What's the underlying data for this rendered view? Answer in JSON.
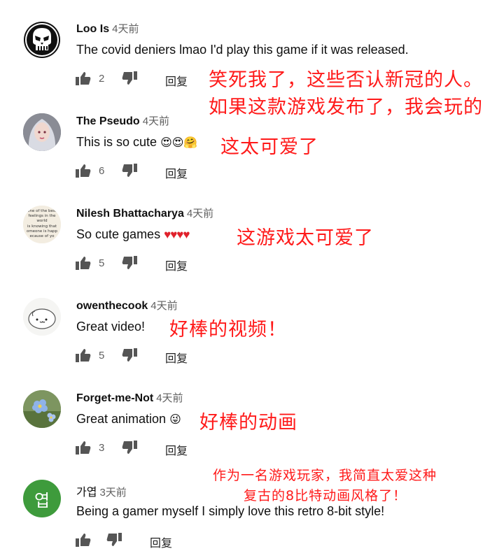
{
  "comments": [
    {
      "author": "Loo Is",
      "time": "4天前",
      "text": "The covid deniers lmao I'd play this game if it was released.",
      "likes": "2",
      "reply_label": "回复",
      "translation": [
        "笑死我了，这些否认新冠的人。",
        "如果这款游戏发布了，我会玩的"
      ]
    },
    {
      "author": "The Pseudo",
      "time": "4天前",
      "text": "This is so cute",
      "emojis": "😍😍🤗",
      "likes": "6",
      "reply_label": "回复",
      "translation": [
        "这太可爱了"
      ]
    },
    {
      "author": "Nilesh Bhattacharya",
      "time": "4天前",
      "text": "So cute games",
      "emojis": "♥♥♥♥",
      "likes": "5",
      "reply_label": "回复",
      "translation": [
        "这游戏太可爱了"
      ],
      "avatar_text": [
        "one of the best",
        "feelings in the",
        "world",
        "is knowing that",
        "omeone is happ",
        "ecause of yo"
      ]
    },
    {
      "author": "owenthecook",
      "time": "4天前",
      "text": "Great video!",
      "likes": "5",
      "reply_label": "回复",
      "translation": [
        "好棒的视频！"
      ]
    },
    {
      "author": "Forget-me-Not",
      "time": "4天前",
      "text": "Great animation",
      "emojis": "😜",
      "likes": "3",
      "reply_label": "回复",
      "translation": [
        "好棒的动画"
      ]
    },
    {
      "author": "가엽",
      "time": "3天前",
      "text": "Being a gamer myself I simply love this retro 8-bit style!",
      "likes": "",
      "reply_label": "回复",
      "avatar_letter": "엽",
      "translation": [
        "作为一名游戏玩家，我简直太爱这种",
        "复古的8比特动画风格了！"
      ]
    }
  ],
  "colors": {
    "annotation": "#ff1a1a",
    "avatar_green": "#3e9b3c",
    "meta_gray": "#606060"
  }
}
